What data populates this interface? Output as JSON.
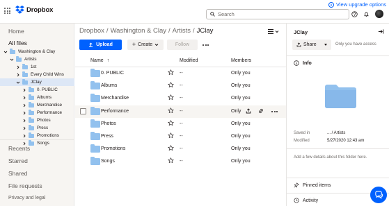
{
  "header": {
    "brand": "Dropbox",
    "upgrade_label": "View upgrade options",
    "search_placeholder": "Search"
  },
  "sidebar": {
    "home": "Home",
    "all_files": "All files",
    "tree": [
      {
        "label": "Washington & Clay",
        "depth": 0,
        "expanded": true
      },
      {
        "label": "Artists",
        "depth": 1,
        "expanded": true
      },
      {
        "label": "1st",
        "depth": 2,
        "expanded": false
      },
      {
        "label": "Every Child Wins",
        "depth": 2,
        "expanded": false
      },
      {
        "label": "JClay",
        "depth": 2,
        "expanded": true,
        "selected": true
      },
      {
        "label": "0. PUBLIC",
        "depth": 3,
        "expanded": false
      },
      {
        "label": "Albums",
        "depth": 3,
        "expanded": false
      },
      {
        "label": "Merchandise",
        "depth": 3,
        "expanded": false
      },
      {
        "label": "Performance",
        "depth": 3,
        "expanded": false
      },
      {
        "label": "Photos",
        "depth": 3,
        "expanded": false
      },
      {
        "label": "Press",
        "depth": 3,
        "expanded": false
      },
      {
        "label": "Promotions",
        "depth": 3,
        "expanded": false
      },
      {
        "label": "Songs",
        "depth": 3,
        "expanded": false
      }
    ],
    "recents": "Recents",
    "starred": "Starred",
    "shared": "Shared",
    "file_requests": "File requests",
    "privacy": "Privacy and legal"
  },
  "main": {
    "breadcrumb": [
      "Dropbox",
      "Washington & Clay",
      "Artists",
      "JClay"
    ],
    "toolbar": {
      "upload": "Upload",
      "create": "Create",
      "follow": "Follow"
    },
    "columns": {
      "name": "Name",
      "sort_arrow": "↑",
      "modified": "Modified",
      "members": "Members"
    },
    "rows": [
      {
        "name": "0. PUBLIC",
        "modified": "--",
        "members": "Only you"
      },
      {
        "name": "Albums",
        "modified": "--",
        "members": "Only you"
      },
      {
        "name": "Merchandise",
        "modified": "--",
        "members": "Only you"
      },
      {
        "name": "Performance",
        "modified": "--",
        "members": "Only",
        "hover": true
      },
      {
        "name": "Photos",
        "modified": "--",
        "members": "Only you"
      },
      {
        "name": "Press",
        "modified": "--",
        "members": "Only you"
      },
      {
        "name": "Promotions",
        "modified": "--",
        "members": "Only you"
      },
      {
        "name": "Songs",
        "modified": "--",
        "members": "Only you"
      }
    ]
  },
  "panel": {
    "title": "JClay",
    "share": "Share",
    "access": "Only you have access",
    "info": "Info",
    "saved_in_label": "Saved in",
    "saved_in_value": "... / Artists",
    "modified_label": "Modified",
    "modified_value": "5/27/2020 12:43 am",
    "hint": "Add a few details about this folder here.",
    "pinned": "Pinned items",
    "activity": "Activity"
  },
  "colors": {
    "accent": "#0061fe",
    "folder": "#92c1ee",
    "selected_row": "#dde7f6"
  },
  "icons": [
    "grid-icon",
    "dropbox-logo",
    "upgrade-icon",
    "search-icon",
    "help-icon",
    "bell-icon",
    "avatar",
    "list-view-icon",
    "upload-icon",
    "plus-icon",
    "star-icon",
    "share-icon",
    "link-icon",
    "info-icon",
    "pin-icon",
    "clock-icon",
    "chat-icon",
    "collapse-panel-icon"
  ]
}
